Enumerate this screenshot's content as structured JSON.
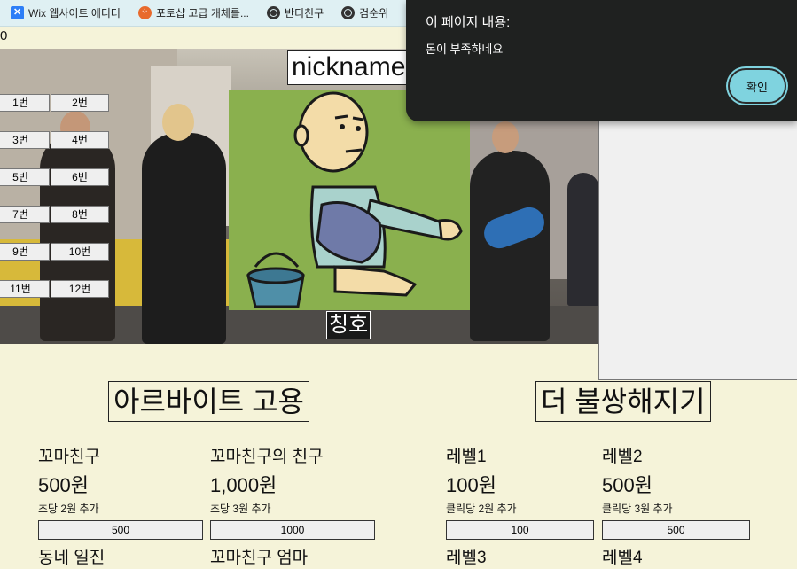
{
  "bookmarks": [
    {
      "label": "Wix 웹사이트 에디터",
      "icon": "wix-icon"
    },
    {
      "label": "포토샵 고급 개체를...",
      "icon": "orange-circle-icon"
    },
    {
      "label": "반티친구",
      "icon": "globe-icon"
    },
    {
      "label": "검순위",
      "icon": "globe-icon"
    }
  ],
  "counter": "0",
  "number_buttons": [
    "1번",
    "2번",
    "3번",
    "4번",
    "5번",
    "6번",
    "7번",
    "8번",
    "9번",
    "10번",
    "11번",
    "12번"
  ],
  "nickname": "nickname",
  "title_badge": "칭호",
  "sections": {
    "hire": {
      "title": "아르바이트 고용",
      "items": [
        {
          "name": "꼬마친구",
          "price": "500원",
          "desc": "초당 2원 추가",
          "button": "500"
        },
        {
          "name": "꼬마친구의 친구",
          "price": "1,000원",
          "desc": "초당 3원 추가",
          "button": "1000"
        }
      ],
      "next_row": [
        "동네 일진",
        "꼬마친구 엄마"
      ]
    },
    "poorer": {
      "title": "더 불쌍해지기",
      "items": [
        {
          "name": "레벨1",
          "price": "100원",
          "desc": "클릭당 2원 추가",
          "button": "100"
        },
        {
          "name": "레벨2",
          "price": "500원",
          "desc": "클릭당 3원 추가",
          "button": "500"
        }
      ],
      "next_row": [
        "레벨3",
        "레벨4"
      ]
    }
  },
  "dialog": {
    "title": "이 페이지 내용:",
    "message": "돈이 부족하네요",
    "ok_label": "확인"
  },
  "colors": {
    "page_bg": "#f5f3d9",
    "dialog_bg": "#1f2120",
    "ok_button": "#7fd3df",
    "character_bg": "#8ab04e"
  }
}
